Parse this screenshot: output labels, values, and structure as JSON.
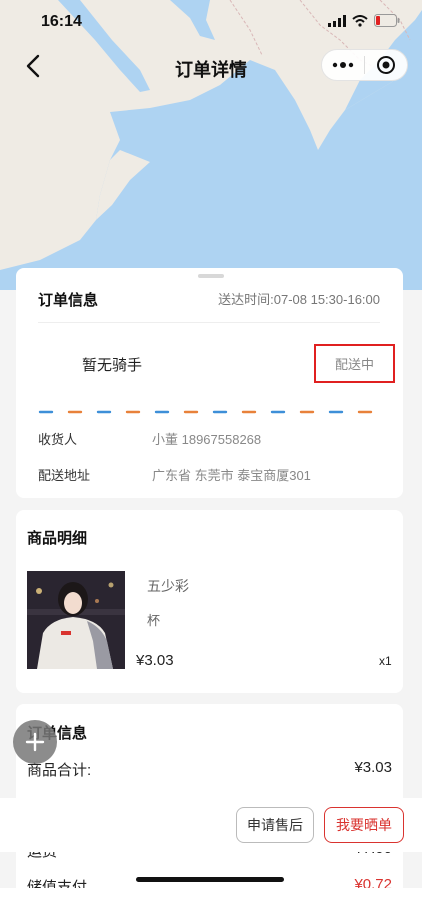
{
  "status_bar": {
    "time": "16:14"
  },
  "nav": {
    "title": "订单详情"
  },
  "order_card": {
    "title": "订单信息",
    "delivery_time": "送达时间:07-08 15:30-16:00",
    "rider": "暂无骑手",
    "status": "配送中",
    "receiver_label": "收货人",
    "receiver_value": "小董 18967558268",
    "address_label": "配送地址",
    "address_value": "广东省 东莞市 泰宝商厦301"
  },
  "goods_card": {
    "title": "商品明细",
    "item": {
      "name": "五少彩",
      "spec": "杯",
      "price": "¥3.03",
      "qty": "x1"
    }
  },
  "summary_card": {
    "title": "订单信息",
    "goods_total_label": "商品合计:",
    "goods_total_value": "¥3.03",
    "freight_label": "运费",
    "freight_value": "¥7.00",
    "stored_label": "储值支付",
    "stored_value": "¥0.72"
  },
  "bottom_bar": {
    "after_sale": "申请售后",
    "show_order": "我要晒单"
  },
  "colors": {
    "accent_red": "#d9332f",
    "status_border": "#e02020",
    "dash_blue": "#3d8fd8",
    "dash_orange": "#e8813a"
  }
}
